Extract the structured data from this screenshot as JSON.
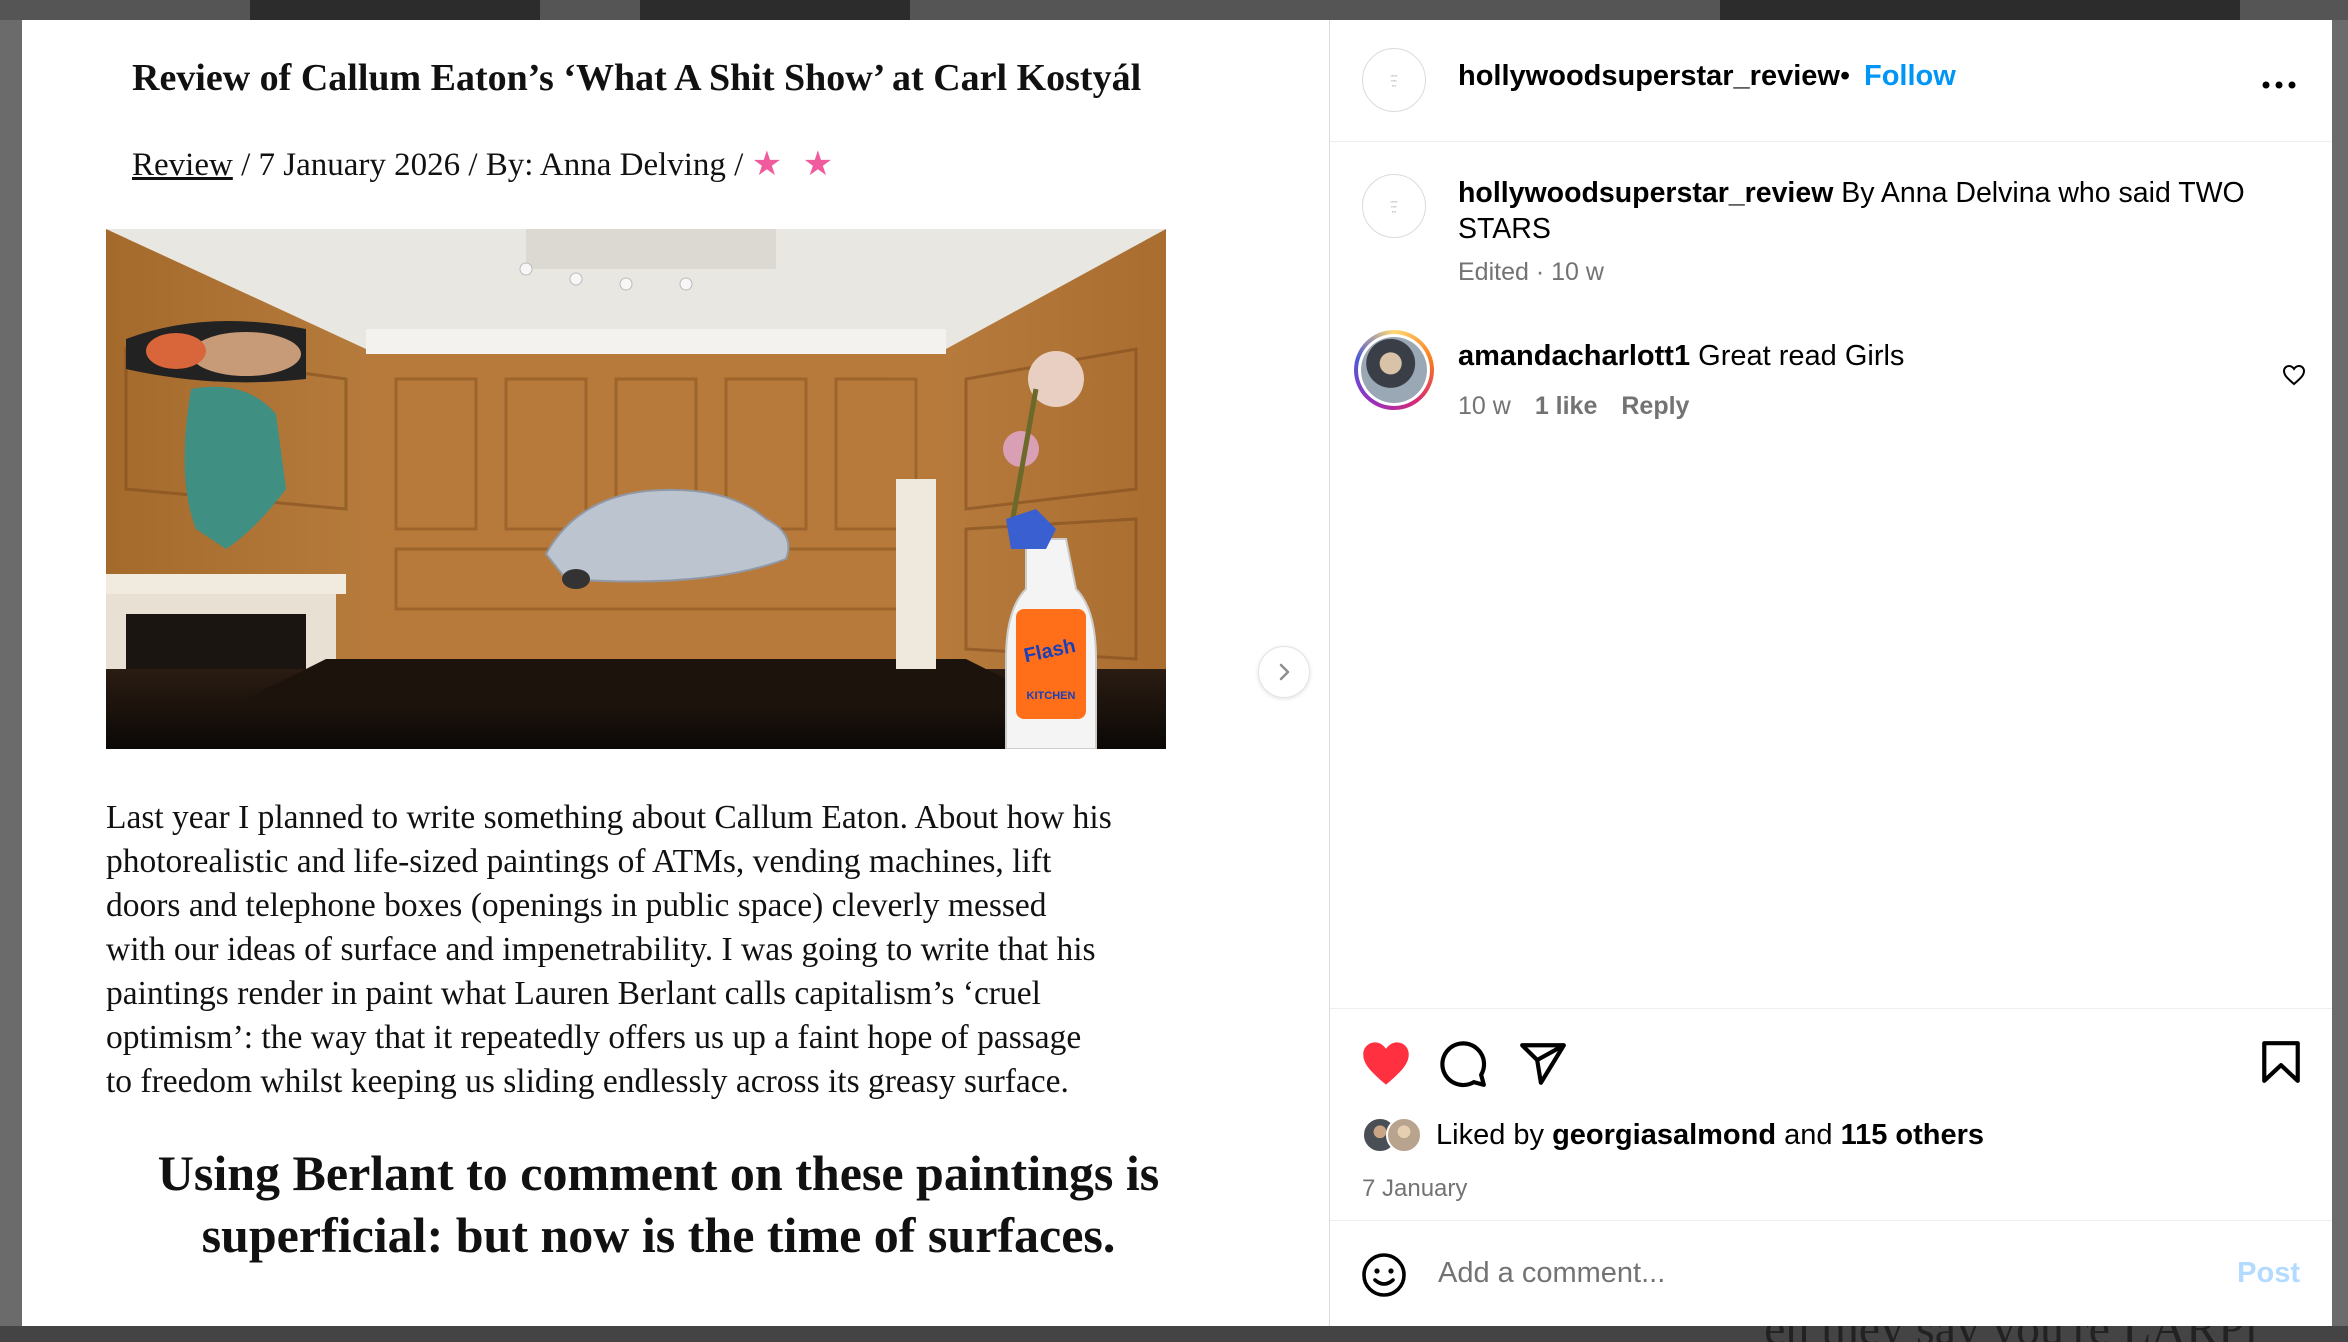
{
  "document": {
    "title": "Review of Callum Eaton’s ‘What A Shit Show’ at Carl Kostyál",
    "meta_link": "Review",
    "meta_rest": " / 7 January 2026 / By: Anna Delving / ",
    "stars": "★ ★",
    "body_lines": [
      "Last year I planned to write something about Callum Eaton. About how his",
      "photorealistic and life-sized paintings of ATMs, vending machines, lift",
      "doors and telephone boxes (openings in public space) cleverly messed",
      "with our ideas of surface and impenetrability. I was going to write that his",
      "paintings render in paint what Lauren Berlant calls capitalism’s ‘cruel",
      "optimism’: the way that it repeatedly offers us up a faint hope of passage",
      "to freedom whilst keeping us sliding endlessly across its greasy surface."
    ],
    "pull_quote_lines": [
      "Using Berlant to comment on these paintings is",
      "superficial: but now is the time of surfaces."
    ],
    "bottle_label": "Flash",
    "bottle_sublabel": "KITCHEN"
  },
  "header": {
    "username": "hollywoodsuperstar_review",
    "separator": "•",
    "follow_label": "Follow",
    "more_icon": "more-horizontal-icon"
  },
  "caption": {
    "username": "hollywoodsuperstar_review",
    "text": " By Anna Delvina who said TWO STARS",
    "meta": "Edited · 10 w"
  },
  "comments": [
    {
      "username": "amandacharlott1",
      "text": " Great read Girls",
      "age": "10 w",
      "likes": "1 like",
      "reply_label": "Reply"
    }
  ],
  "actions": {
    "like_icon": "heart-filled-icon",
    "comment_icon": "comment-icon",
    "share_icon": "share-icon",
    "save_icon": "bookmark-icon",
    "liked_prefix": "Liked by ",
    "liked_user": "georgiasalmond",
    "liked_and": " and ",
    "liked_others": "115 others",
    "date": "7 January",
    "like_color": "#ff3040"
  },
  "comment_box": {
    "placeholder": "Add a comment...",
    "post_label": "Post",
    "emoji_icon": "emoji-icon"
  },
  "background": {
    "caption_fragment": "en they say you're LARPi"
  },
  "colors": {
    "accent": "#0095f6",
    "muted": "#737373",
    "post_disabled": "#b3dbff",
    "stars": "#ef5b9c"
  }
}
